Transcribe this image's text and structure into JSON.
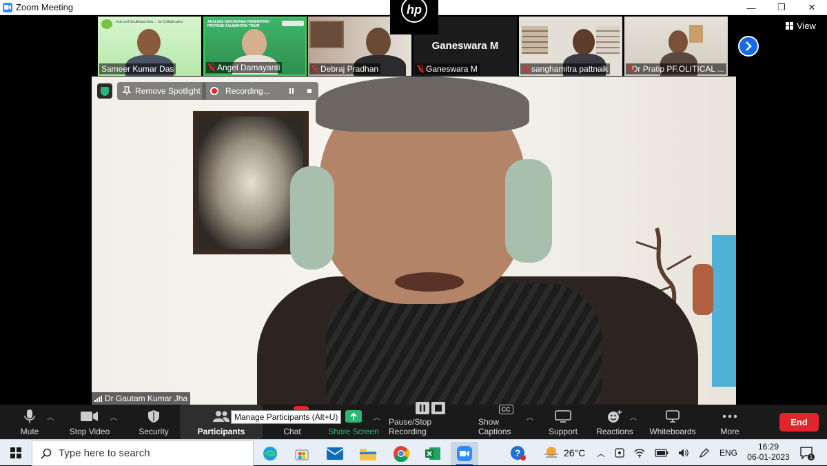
{
  "window": {
    "title": "Zoom Meeting",
    "controls": [
      "—",
      "❐",
      "✕"
    ]
  },
  "strip": {
    "participants": [
      {
        "name": "Sameer Kumar Das",
        "muted": false,
        "poster_text": "Indo and Southeast Asia ... for Collaboration"
      },
      {
        "name": "Angel Damayanti",
        "muted": true,
        "poster_text": "ANALISIS KERJASAMA PEMERINTAH PROVINSI KALIMANTAN TIMUR"
      },
      {
        "name": "Debraj Pradhan",
        "muted": true
      },
      {
        "name": "Ganeswara M",
        "muted": true,
        "tile_title": "Ganeswara M"
      },
      {
        "name": "sanghamitra pattnaik",
        "muted": true
      },
      {
        "name": "Dr Pratip PF.OLITICAL ...",
        "muted": true
      }
    ],
    "view_label": "View",
    "next_icon": "chevron-right-icon"
  },
  "main": {
    "speaker_name": "Dr Gautam Kumar Jha",
    "remove_spotlight": "Remove Spotlight",
    "recording_label": "Recording..."
  },
  "toolbar": {
    "mute": "Mute",
    "stop_video": "Stop Video",
    "security": "Security",
    "participants": "Participants",
    "participants_tooltip": "Manage Participants (Alt+U)",
    "chat": "Chat",
    "share_screen": "Share Screen",
    "pause_stop_recording": "Pause/Stop Recording",
    "show_captions": "Show Captions",
    "cc": "CC",
    "support": "Support",
    "reactions": "Reactions",
    "whiteboards": "Whiteboards",
    "more": "More",
    "end": "End",
    "colors": {
      "share": "#2bb673",
      "end": "#e0262b",
      "accent": "#1769e8"
    }
  },
  "taskbar": {
    "search_placeholder": "Type here to search",
    "temperature": "26°C",
    "language": "ENG",
    "time": "16:29",
    "date": "06-01-2023",
    "notification_count": "1"
  }
}
